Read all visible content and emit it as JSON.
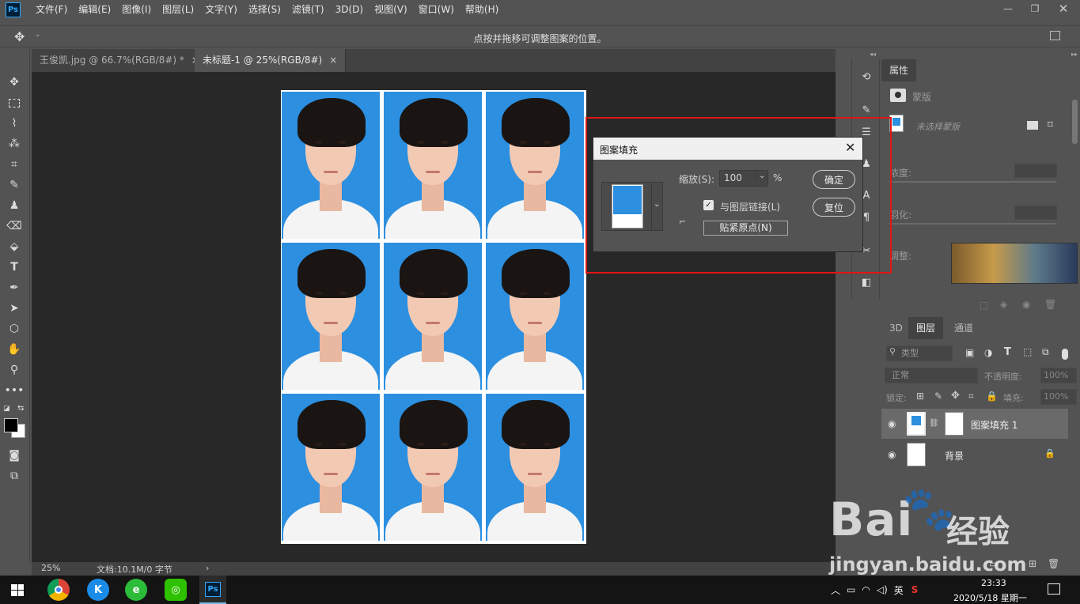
{
  "app": {
    "logo": "Ps"
  },
  "menu": [
    "文件(F)",
    "编辑(E)",
    "图像(I)",
    "图层(L)",
    "文字(Y)",
    "选择(S)",
    "滤镜(T)",
    "3D(D)",
    "视图(V)",
    "窗口(W)",
    "帮助(H)"
  ],
  "options_bar": {
    "hint": "点按并拖移可调整图案的位置。"
  },
  "tabs": [
    {
      "label": "王俊凯.jpg @ 66.7%(RGB/8#) *",
      "close": "×"
    },
    {
      "label": "未标题-1 @ 25%(RGB/8#)",
      "close": "×"
    }
  ],
  "status": {
    "zoom": "25%",
    "doc": "文档:10.1M/0 字节",
    "arrow": "›"
  },
  "properties": {
    "tab": "属性",
    "mask_label": "蒙版",
    "selected": "未选择蒙版",
    "density": "浓度:",
    "feather": "羽化:",
    "adjust": "调整:"
  },
  "layers": {
    "tabs": [
      "3D",
      "图层",
      "通道"
    ],
    "filter": "类型",
    "blend": "正常",
    "opacity_label": "不透明度:",
    "opacity": "100%",
    "lock_label": "锁定:",
    "fill_label": "填充:",
    "fill": "100%",
    "items": [
      {
        "name": "图案填充 1",
        "selected": true
      },
      {
        "name": "背景",
        "locked": true
      }
    ]
  },
  "dialog": {
    "title": "图案填充",
    "scale_label": "缩放(S):",
    "scale_value": "100",
    "percent": "%",
    "link_label": "与图层链接(L)",
    "snap_button": "贴紧原点(N)",
    "ok": "确定",
    "reset": "复位"
  },
  "taskbar": {
    "time": "23:33",
    "date": "2020/5/18 星期一",
    "lang": "英",
    "ps_label": "Ps"
  },
  "watermark": {
    "line1": "Bai",
    "line2": "经验",
    "url": "jingyan.baidu.com"
  },
  "colors": {
    "accent": "#31a8ff",
    "highlight": "#e01515",
    "photo_bg": "#2c8fe0"
  }
}
